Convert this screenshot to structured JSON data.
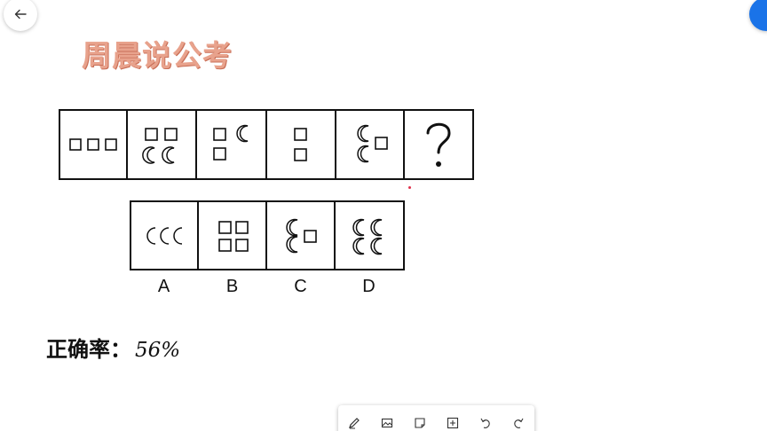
{
  "brand": {
    "title": "周晨说公考",
    "color": "#e8a28c"
  },
  "accent_color": "#1a73e8",
  "puzzle": {
    "stimulus_panels": [
      {
        "content": "three-squares-horizontal"
      },
      {
        "content": "two-squares-over-two-crescents"
      },
      {
        "content": "two-squares-one-crescent"
      },
      {
        "content": "two-squares-vertical"
      },
      {
        "content": "two-crescents-one-square"
      },
      {
        "content": "question-mark",
        "text": "?"
      }
    ],
    "options": [
      {
        "label": "A",
        "content": "three-crescents-horizontal"
      },
      {
        "label": "B",
        "content": "four-squares-grid"
      },
      {
        "label": "C",
        "content": "two-crescents-one-square"
      },
      {
        "label": "D",
        "content": "four-crescents-grid"
      }
    ]
  },
  "answer": {
    "label": "正确率：",
    "value": "56%"
  },
  "toolbar": {
    "tools": [
      {
        "icon": "pen-icon"
      },
      {
        "icon": "image-icon"
      },
      {
        "icon": "sticky-note-icon"
      },
      {
        "icon": "add-box-icon"
      },
      {
        "icon": "undo-icon"
      },
      {
        "icon": "redo-icon"
      }
    ]
  },
  "navigation": {
    "back_icon": "arrow-left-icon"
  }
}
